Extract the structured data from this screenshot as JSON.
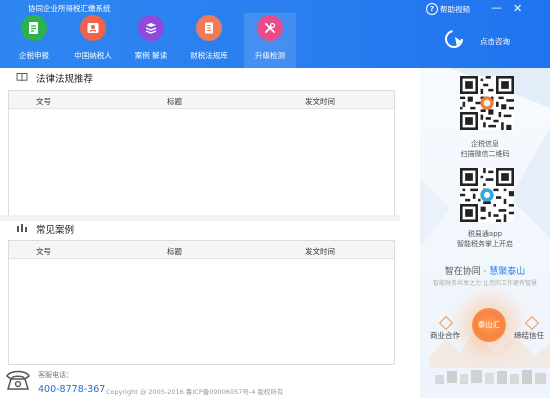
{
  "app": {
    "title": "协同企业所得税汇缴系统",
    "help_label": "帮助视频",
    "minimize": "—",
    "close": "✕",
    "consult_label": "点击咨询"
  },
  "nav": [
    {
      "label": "企税申报",
      "icon": "document-edit-icon",
      "color": "#2bb24c"
    },
    {
      "label": "中国纳税人",
      "icon": "taxpayer-icon",
      "color": "#f0634a"
    },
    {
      "label": "案例  解读",
      "icon": "books-icon",
      "color": "#8e4ad8"
    },
    {
      "label": "财税法规库",
      "icon": "law-library-icon",
      "color": "#f07b5a"
    },
    {
      "label": "升级检测",
      "icon": "tools-icon",
      "color": "#e84c8a",
      "active": true
    }
  ],
  "sections": {
    "laws": {
      "title": "法律法规推荐",
      "columns": [
        "文号",
        "标题",
        "发文时间"
      ],
      "rows": []
    },
    "cases": {
      "title": "常见案例",
      "columns": [
        "文号",
        "标题",
        "发文时间"
      ],
      "rows": []
    }
  },
  "right": {
    "qr1_caption1": "企税信息",
    "qr1_caption2": "扫描微信二维码",
    "qr2_caption1": "税易通app",
    "qr2_caption2": "智能税务掌上开启",
    "slogan_part1": "智在协同 · ",
    "slogan_part2": "慧聚泰山",
    "slogan_sub": "智能财务共享之力 让您的工作更有智慧",
    "sun_label": "泰山汇",
    "feature_left": "商业合作",
    "feature_right": "缔结信任"
  },
  "footer": {
    "label": "客服电话：",
    "phone": "400-8778-367",
    "copyright": "Copyright @ 2005-2016  鲁ICP备09006057号-4  版权所有"
  },
  "colors": {
    "header": "#2a7ff0",
    "accent": "#2a7fe8",
    "phone": "#2a6fc9"
  }
}
